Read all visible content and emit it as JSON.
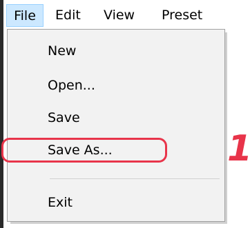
{
  "menubar": {
    "items": [
      {
        "label": "File"
      },
      {
        "label": "Edit"
      },
      {
        "label": "View"
      },
      {
        "label": "Preset"
      }
    ]
  },
  "file_menu": {
    "items": [
      {
        "label": "New"
      },
      {
        "label": "Open..."
      },
      {
        "label": "Save"
      },
      {
        "label": "Save As..."
      },
      {
        "label": "Exit"
      }
    ]
  },
  "annotation": {
    "step_number": "1",
    "highlight_color": "#e8344a"
  }
}
